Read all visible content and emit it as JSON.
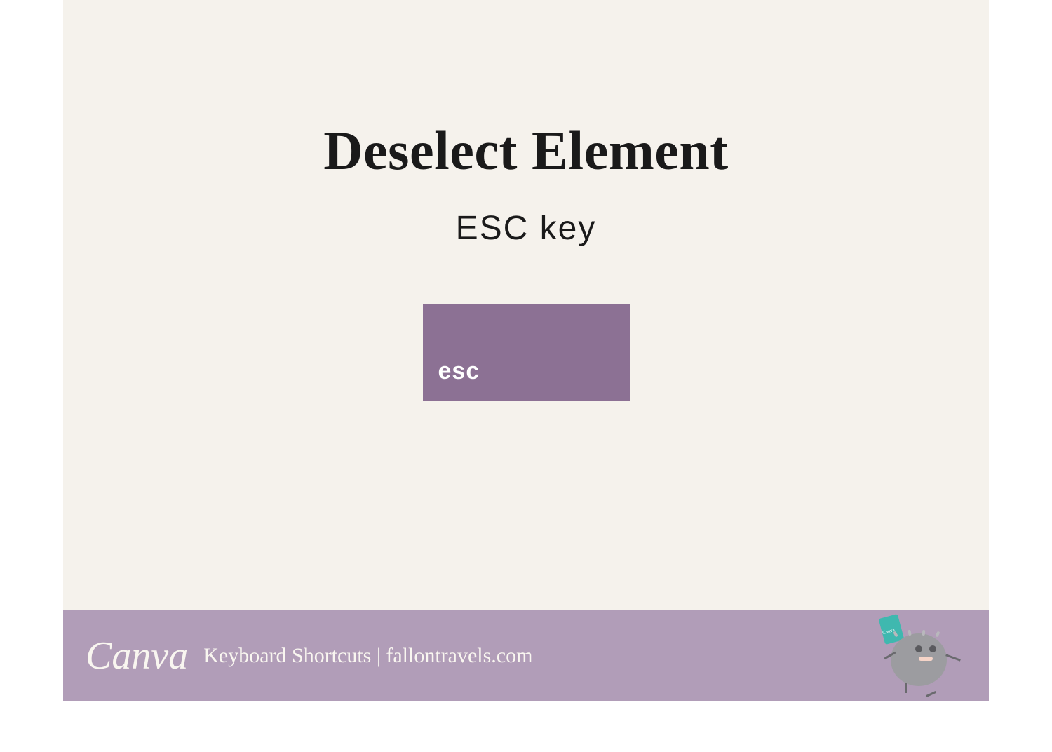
{
  "main": {
    "title": "Deselect Element",
    "subtitle": "ESC key",
    "key_label": "esc"
  },
  "footer": {
    "logo": "Canva",
    "text": "Keyboard Shortcuts  |  fallontravels.com",
    "mascot_flag": "Canva"
  }
}
